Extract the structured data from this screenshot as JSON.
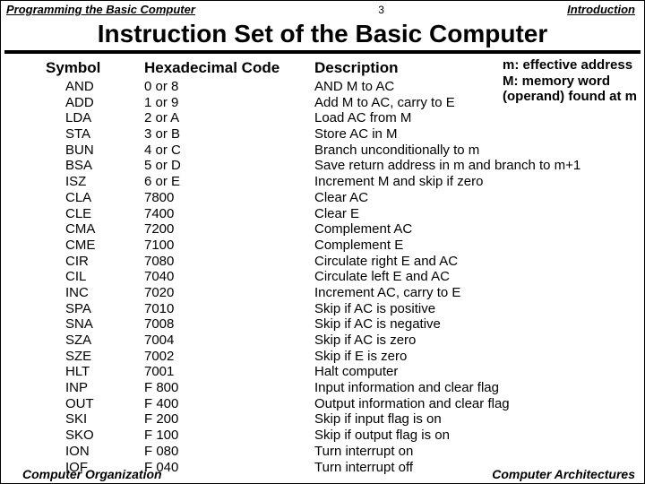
{
  "top": {
    "left": "Programming the Basic Computer",
    "page": "3",
    "right": "Introduction"
  },
  "title": "Instruction Set of the Basic Computer",
  "legend": {
    "l1": "m: effective address",
    "l2": "M: memory word",
    "l3": "(operand) found at m"
  },
  "headers": {
    "symbol": "Symbol",
    "hex": "Hexadecimal Code",
    "desc": "Description"
  },
  "rows": [
    {
      "sym": "AND",
      "hex": "0 or 8",
      "desc": "AND M to AC"
    },
    {
      "sym": "ADD",
      "hex": "1 or 9",
      "desc": "Add M to AC, carry to E"
    },
    {
      "sym": "LDA",
      "hex": "2 or A",
      "desc": "Load AC from M"
    },
    {
      "sym": "STA",
      "hex": "3 or B",
      "desc": "Store AC in M"
    },
    {
      "sym": "BUN",
      "hex": "4 or C",
      "desc": "Branch unconditionally to m"
    },
    {
      "sym": "BSA",
      "hex": "5 or D",
      "desc": "Save return address in m and branch to m+1"
    },
    {
      "sym": "ISZ",
      "hex": "6 or E",
      "desc": "Increment M and skip if zero"
    },
    {
      "sym": "CLA",
      "hex": "7800",
      "desc": "Clear AC"
    },
    {
      "sym": "CLE",
      "hex": "7400",
      "desc": "Clear E"
    },
    {
      "sym": "CMA",
      "hex": "7200",
      "desc": "Complement AC"
    },
    {
      "sym": "CME",
      "hex": "7100",
      "desc": "Complement E"
    },
    {
      "sym": "CIR",
      "hex": "7080",
      "desc": "Circulate right E and AC"
    },
    {
      "sym": "CIL",
      "hex": "7040",
      "desc": "Circulate left E and AC"
    },
    {
      "sym": "INC",
      "hex": "7020",
      "desc": "Increment AC, carry to E"
    },
    {
      "sym": "SPA",
      "hex": "7010",
      "desc": "Skip if AC is positive"
    },
    {
      "sym": "SNA",
      "hex": "7008",
      "desc": "Skip if AC is negative"
    },
    {
      "sym": "SZA",
      "hex": "7004",
      "desc": "Skip if AC is zero"
    },
    {
      "sym": "SZE",
      "hex": "7002",
      "desc": "Skip if E is zero"
    },
    {
      "sym": "HLT",
      "hex": "7001",
      "desc": "Halt computer"
    },
    {
      "sym": "INP",
      "hex": "F 800",
      "desc": "Input information and clear flag"
    },
    {
      "sym": "OUT",
      "hex": "F 400",
      "desc": "Output information and clear flag"
    },
    {
      "sym": "SKI",
      "hex": "F 200",
      "desc": "Skip if input flag is on"
    },
    {
      "sym": "SKO",
      "hex": "F 100",
      "desc": "Skip if output flag is on"
    },
    {
      "sym": "ION",
      "hex": "F 080",
      "desc": "Turn interrupt on"
    },
    {
      "sym": "IOF",
      "hex": "F 040",
      "desc": "Turn interrupt off"
    }
  ],
  "footer": {
    "left": "Computer Organization",
    "right": "Computer Architectures"
  }
}
